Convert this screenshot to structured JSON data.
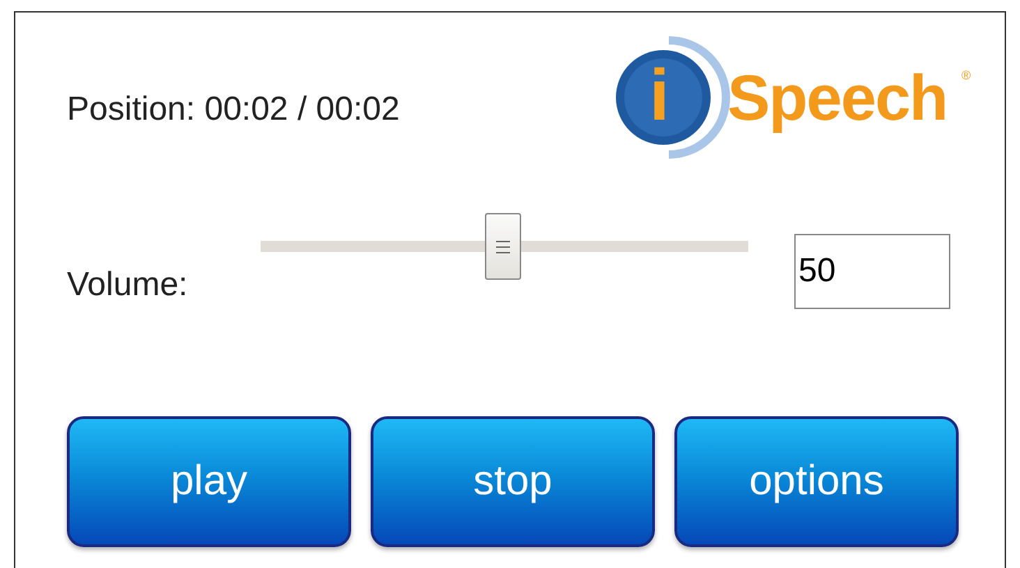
{
  "position": {
    "label": "Position:",
    "value": "00:02 / 00:02"
  },
  "logo": {
    "letter": "i",
    "word": "Speech",
    "mark": "®"
  },
  "volume": {
    "label": "Volume:",
    "level": 0.5,
    "value": "50"
  },
  "buttons": [
    {
      "label": "play"
    },
    {
      "label": "stop"
    },
    {
      "label": "options"
    }
  ]
}
